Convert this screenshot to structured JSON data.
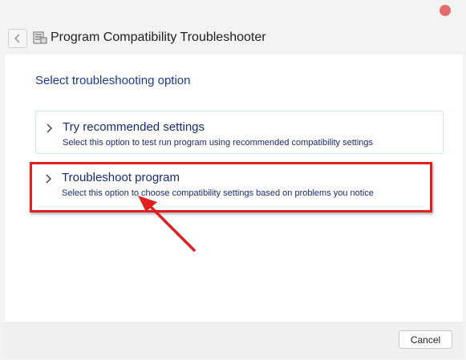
{
  "window": {
    "title": "Program Compatibility Troubleshooter"
  },
  "icons": {
    "back": "back-arrow-icon",
    "app": "troubleshooter-app-icon",
    "close": "close-icon",
    "chevron": "chevron-right-icon"
  },
  "main": {
    "heading": "Select troubleshooting option",
    "options": [
      {
        "title": "Try recommended settings",
        "description": "Select this option to test run program using recommended compatibility settings"
      },
      {
        "title": "Troubleshoot program",
        "description": "Select this option to choose compatibility settings based on problems you notice"
      }
    ]
  },
  "footer": {
    "cancel_label": "Cancel"
  },
  "colors": {
    "heading": "#1b3a8c",
    "option_text": "#1b2a6b",
    "annotation_red": "#e02020",
    "close_button": "#e06d6d"
  }
}
